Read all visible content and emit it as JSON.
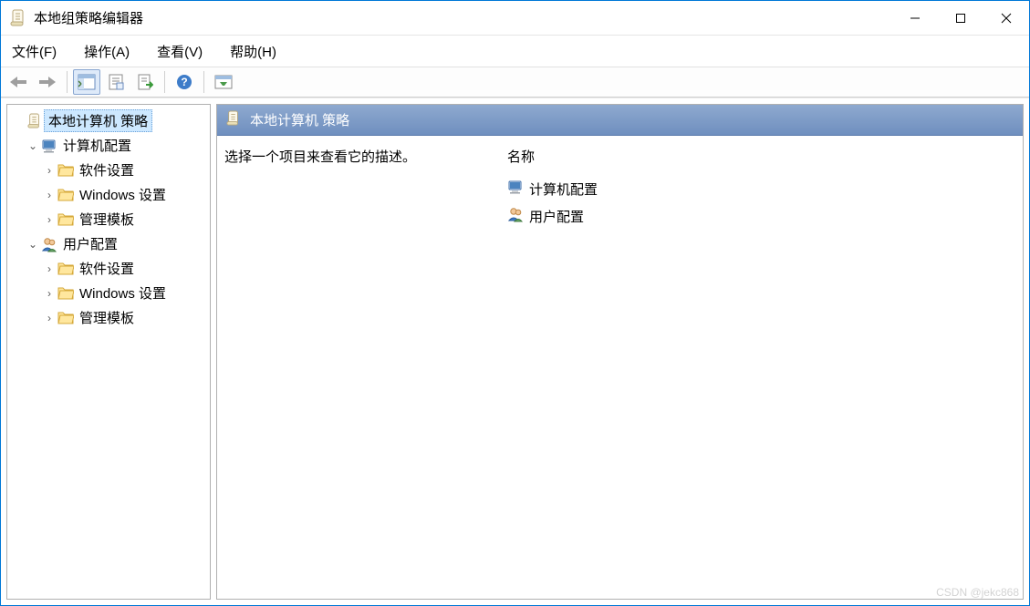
{
  "window": {
    "title": "本地组策略编辑器"
  },
  "menu": {
    "file": "文件(F)",
    "action": "操作(A)",
    "view": "查看(V)",
    "help": "帮助(H)"
  },
  "tree": {
    "root": "本地计算机 策略",
    "computer": "计算机配置",
    "user": "用户配置",
    "sw": "软件设置",
    "win": "Windows 设置",
    "admin": "管理模板"
  },
  "content": {
    "header": "本地计算机 策略",
    "desc": "选择一个项目来查看它的描述。",
    "col_name": "名称",
    "items": {
      "computer": "计算机配置",
      "user": "用户配置"
    }
  },
  "watermark": "CSDN @jekc868"
}
